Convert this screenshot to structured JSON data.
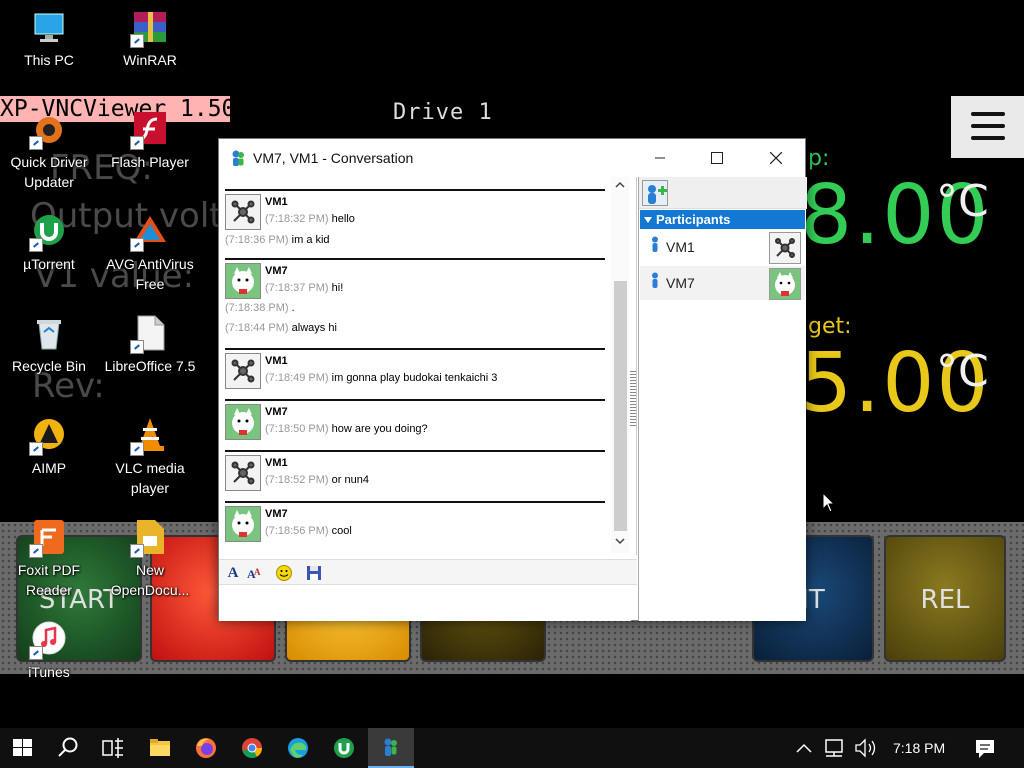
{
  "background_app": {
    "title": "XP-VNCViewer 1.50",
    "drive_label": "Drive 1",
    "labels": [
      "FREQ:",
      "Output volta",
      "V1 value:",
      "Rev:"
    ],
    "temp_label_1": "p:",
    "temp_value_1": "8.00",
    "temp_label_2": "get:",
    "temp_value_2": "5.00",
    "unit": "°C",
    "buttons": {
      "start": "START",
      "it": "IT",
      "rel": "REL"
    }
  },
  "desktop": {
    "icons": [
      {
        "label": "This PC",
        "icon": "pc-icon"
      },
      {
        "label": "WinRAR",
        "icon": "winrar-icon"
      },
      {
        "label": "Quick Driver Updater",
        "icon": "driver-updater-icon"
      },
      {
        "label": "Flash Player",
        "icon": "flash-icon"
      },
      {
        "label": "µTorrent",
        "icon": "utorrent-icon"
      },
      {
        "label": "AVG AntiVirus Free",
        "icon": "avg-icon"
      },
      {
        "label": "Recycle Bin",
        "icon": "recycle-bin-icon"
      },
      {
        "label": "LibreOffice 7.5",
        "icon": "libreoffice-icon"
      },
      {
        "label": "AIMP",
        "icon": "aimp-icon"
      },
      {
        "label": "VLC media player",
        "icon": "vlc-icon"
      },
      {
        "label": "Foxit PDF Reader",
        "icon": "foxit-icon"
      },
      {
        "label": "New OpenDocu...",
        "icon": "document-icon"
      },
      {
        "label": "iTunes",
        "icon": "itunes-icon"
      }
    ]
  },
  "conversation": {
    "title": "VM7, VM1 - Conversation",
    "messages": [
      {
        "sender": "VM1",
        "avatar": "robot-avatar",
        "lines": [
          {
            "time": "(7:18:32 PM)",
            "text": "hello"
          },
          {
            "time": "(7:18:36 PM)",
            "text": "im a kid"
          }
        ]
      },
      {
        "sender": "VM7",
        "avatar": "lucky-cat-avatar",
        "lines": [
          {
            "time": "(7:18:37 PM)",
            "text": "hi!"
          },
          {
            "time": "(7:18:38 PM)",
            "text": "."
          },
          {
            "time": "(7:18:44 PM)",
            "text": "always hi"
          }
        ]
      },
      {
        "sender": "VM1",
        "avatar": "robot-avatar",
        "lines": [
          {
            "time": "(7:18:49 PM)",
            "text": "im gonna play  budokai tenkaichi 3"
          }
        ]
      },
      {
        "sender": "VM7",
        "avatar": "lucky-cat-avatar",
        "lines": [
          {
            "time": "(7:18:50 PM)",
            "text": "how are you doing?"
          }
        ]
      },
      {
        "sender": "VM1",
        "avatar": "robot-avatar",
        "lines": [
          {
            "time": "(7:18:52 PM)",
            "text": "or nun4"
          }
        ]
      },
      {
        "sender": "VM7",
        "avatar": "lucky-cat-avatar",
        "lines": [
          {
            "time": "(7:18:56 PM)",
            "text": "cool"
          }
        ]
      }
    ],
    "input_value": "",
    "participants_header": "Participants",
    "participants": [
      {
        "name": "VM1",
        "avatar": "robot-avatar"
      },
      {
        "name": "VM7",
        "avatar": "lucky-cat-avatar"
      }
    ]
  },
  "taskbar": {
    "clock": "7:18 PM",
    "items": [
      "start-icon",
      "search-icon",
      "task-view-icon",
      "file-explorer-icon",
      "firefox-icon",
      "chrome-icon",
      "edge-icon",
      "utorrent-icon",
      "messenger-icon"
    ]
  },
  "colors": {
    "participants_header": "#1378d4",
    "temp_value_1": "#33cc55",
    "temp_value_2": "#e8c81a",
    "vnc_title_bg": "#ffb3b3"
  }
}
